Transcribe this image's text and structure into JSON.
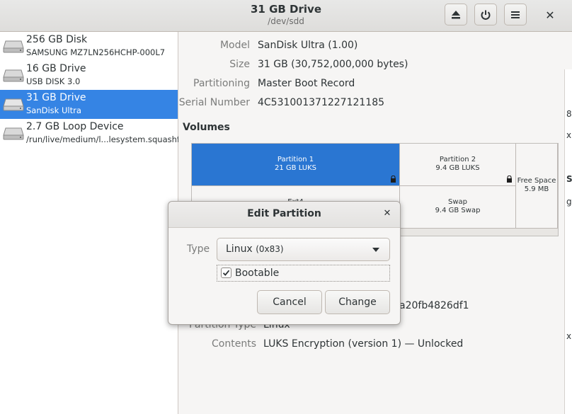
{
  "window": {
    "title": "31 GB Drive",
    "subtitle": "/dev/sdd",
    "buttons": {
      "eject_icon": "eject-icon",
      "power_icon": "power-icon",
      "menu_icon": "hamburger-menu-icon",
      "close": "✕"
    }
  },
  "sidebar": {
    "items": [
      {
        "name": "256 GB Disk",
        "detail": "SAMSUNG MZ7LN256HCHP-000L7",
        "selected": false
      },
      {
        "name": "16 GB Drive",
        "detail": "USB DISK 3.0",
        "selected": false
      },
      {
        "name": "31 GB Drive",
        "detail": "SanDisk Ultra",
        "selected": true
      },
      {
        "name": "2.7 GB Loop Device",
        "detail": "/run/live/medium/l...lesystem.squashfs",
        "selected": false
      }
    ]
  },
  "drive": {
    "model_label": "Model",
    "model": "SanDisk Ultra (1.00)",
    "size_label": "Size",
    "size": "31 GB (30,752,000,000 bytes)",
    "partitioning_label": "Partitioning",
    "partitioning": "Master Boot Record",
    "serial_label": "Serial Number",
    "serial": "4C531001371227121185"
  },
  "volumes": {
    "title": "Volumes",
    "partitions": [
      {
        "name": "Partition 1",
        "detail": "21 GB LUKS",
        "selected": true,
        "locked": true
      },
      {
        "name": "Partition 2",
        "detail": "9.4 GB LUKS",
        "selected": false,
        "locked": true
      },
      {
        "name": "Free Space",
        "detail": "5.9 MB",
        "selected": false
      },
      {
        "name": "Ext4",
        "detail": "",
        "selected": false
      },
      {
        "name": "Swap",
        "detail": "9.4 GB Swap",
        "selected": false
      }
    ]
  },
  "details": {
    "uuid_partial": "a20fb4826df1",
    "partition_type_label": "Partition Type",
    "partition_type": "Linux",
    "contents_label": "Contents",
    "contents": "LUKS Encryption (version 1) — Unlocked"
  },
  "dialog": {
    "title": "Edit Partition",
    "type_label": "Type",
    "type_value": "Linux",
    "type_code": "(0x83)",
    "bootable_label": "Bootable",
    "bootable_checked": true,
    "cancel_label": "Cancel",
    "change_label": "Change"
  },
  "colors": {
    "accent": "#3584e4",
    "partition_selected": "#2a76d2"
  }
}
